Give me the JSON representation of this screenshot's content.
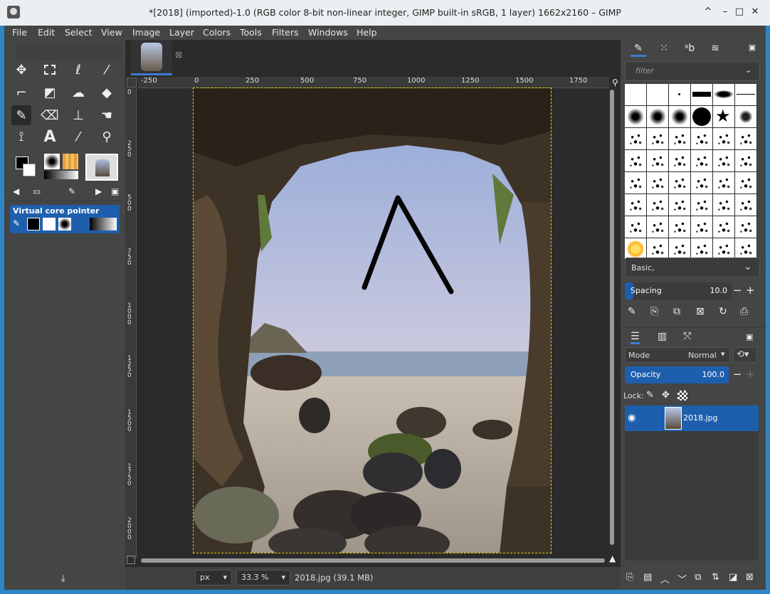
{
  "window": {
    "title": "*[2018] (imported)-1.0 (RGB color 8-bit non-linear integer, GIMP built-in sRGB, 1 layer) 1662x2160 – GIMP",
    "controls": [
      "^",
      "–",
      "□",
      "✕"
    ]
  },
  "menu": [
    "File",
    "Edit",
    "Select",
    "View",
    "Image",
    "Layer",
    "Colors",
    "Tools",
    "Filters",
    "Windows",
    "Help"
  ],
  "toolbox": {
    "tools": [
      "move-icon",
      "rect-select-icon",
      "lasso-icon",
      "fuzzy-select-icon",
      "crop-icon",
      "transform-icon",
      "warp-icon",
      "bucket-fill-icon",
      "paintbrush-icon",
      "eraser-icon",
      "clone-icon",
      "smudge-icon",
      "paths-icon",
      "text-icon",
      "color-picker-icon",
      "zoom-icon"
    ],
    "pointer_panel_label": "Virtual core pointer"
  },
  "ruler": {
    "h_ticks": [
      "-250",
      "0",
      "250",
      "500",
      "750",
      "1000",
      "1250",
      "1500",
      "1750"
    ],
    "v_ticks": [
      "0",
      "2\n5\n0",
      "5\n0\n0",
      "7\n5\n0",
      "1\n0\n0\n0",
      "1\n2\n5\n0",
      "1\n5\n0\n0",
      "1\n7\n5\n0",
      "2\n0\n0\n0"
    ]
  },
  "statusbar": {
    "unit": "px",
    "zoom": "33.3 %",
    "file_info": "2018.jpg (39.1 MB)"
  },
  "brushes": {
    "filter_placeholder": "filter",
    "preset": "Basic,",
    "spacing_label": "Spacing",
    "spacing_value": "10.0",
    "spacing_percent": 0.08
  },
  "layers": {
    "mode_label": "Mode",
    "mode_value": "Normal",
    "opacity_label": "Opacity",
    "opacity_value": "100.0",
    "lock_label": "Lock:",
    "items": [
      {
        "name": "2018.jpg",
        "visible": true
      }
    ]
  },
  "colors": {
    "accent": "#1e5fad",
    "selection": "#e6d200",
    "titlebar_border": "#2e86c8"
  }
}
